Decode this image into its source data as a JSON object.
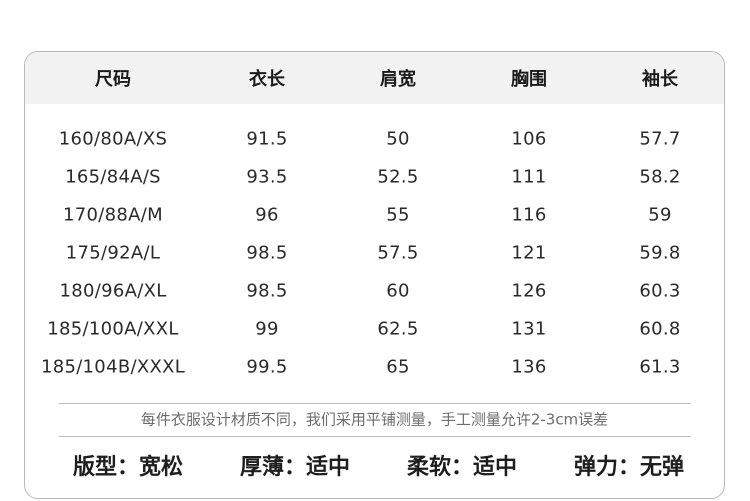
{
  "table": {
    "headers": [
      "尺码",
      "衣长",
      "肩宽",
      "胸围",
      "袖长"
    ],
    "rows": [
      [
        "160/80A/XS",
        "91.5",
        "50",
        "106",
        "57.7"
      ],
      [
        "165/84A/S",
        "93.5",
        "52.5",
        "111",
        "58.2"
      ],
      [
        "170/88A/M",
        "96",
        "55",
        "116",
        "59"
      ],
      [
        "175/92A/L",
        "98.5",
        "57.5",
        "121",
        "59.8"
      ],
      [
        "180/96A/XL",
        "98.5",
        "60",
        "126",
        "60.3"
      ],
      [
        "185/100A/XXL",
        "99",
        "62.5",
        "131",
        "60.8"
      ],
      [
        "185/104B/XXXL",
        "99.5",
        "65",
        "136",
        "61.3"
      ]
    ]
  },
  "note": "每件衣服设计材质不同，我们采用平铺测量，手工测量允许2-3cm误差",
  "properties": [
    "版型：宽松",
    "厚薄：适中",
    "柔软：适中",
    "弹力：无弹"
  ],
  "colors": {
    "header_bg": "#f2f2f2",
    "border": "#b9b9b9",
    "text": "#222222",
    "note_text": "#6d6d6d"
  }
}
